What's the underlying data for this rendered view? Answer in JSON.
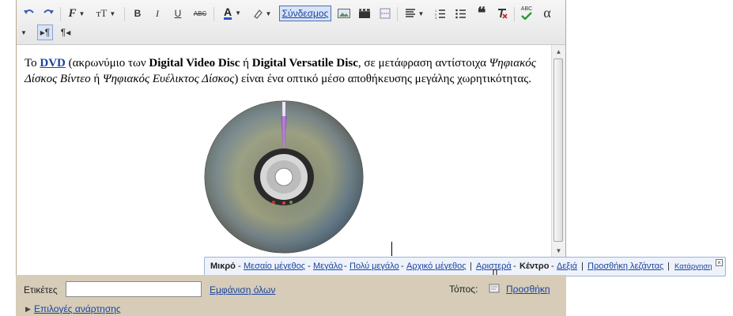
{
  "toolbar": {
    "link_label": "Σύνδεσμος",
    "alpha_label": "α",
    "bold_label": "B",
    "italic_label": "I",
    "underline_label": "U",
    "strike_label": "ABC",
    "text_color_label": "A",
    "spell_label": "ABC",
    "font_label": "F",
    "size_label": "тT",
    "ltr_label": "▸¶",
    "rtl_label": "¶◂",
    "icons": [
      "undo-icon",
      "redo-icon",
      "font-icon",
      "font-size-icon",
      "bold-icon",
      "italic-icon",
      "underline-icon",
      "strikethrough-icon",
      "text-color-icon",
      "highlight-icon",
      "image-icon",
      "video-icon",
      "jump-break-icon",
      "align-icon",
      "numbered-list-icon",
      "bulleted-list-icon",
      "blockquote-icon",
      "remove-format-icon",
      "spellcheck-icon",
      "special-char-icon",
      "ltr-icon",
      "rtl-icon"
    ]
  },
  "content": {
    "p_to": "Το ",
    "dvd": "DVD",
    "p_1": " (ακρωνύμιο των ",
    "b_1": "Digital Video Disc",
    "p_2": " ή ",
    "b_2": "Digital Versatile Disc",
    "p_3": ", σε μετάφραση αντίστοιχα ",
    "i_1": "Ψηφιακός Δίσκος Βίντεο",
    "p_4": " ή ",
    "i_2": "Ψηφιακός Ευέλικτος Δίσκος",
    "p_5": ") είναι ένα οπτικό μέσο αποθήκευσης μεγάλης χωρητικότητας."
  },
  "image_size_bar": {
    "small": "Μικρό",
    "medium": "Μεσαίο μέγεθος",
    "large": "Μεγάλο",
    "xlarge": "Πολύ μεγάλο",
    "original": "Αρχικό μέγεθος",
    "left": "Αριστερά",
    "center": "Κέντρο",
    "right": "Δεξιά",
    "caption": "Προσθήκη λεζάντας",
    "remove": "Κατάργηση",
    "dash": "-",
    "pipe": "|",
    "close": "×"
  },
  "bottom": {
    "labels_label": "Ετικέτες",
    "labels_value": "",
    "show_all": "Εμφάνιση όλων",
    "location_label": "Τόπος:",
    "add_link": "Προσθήκη",
    "post_options": "Επιλογές ανάρτησης"
  },
  "colors": {
    "link": "#1a44a0",
    "panel": "#d6ccb8",
    "size_bar_bg": "#eef2fa"
  }
}
